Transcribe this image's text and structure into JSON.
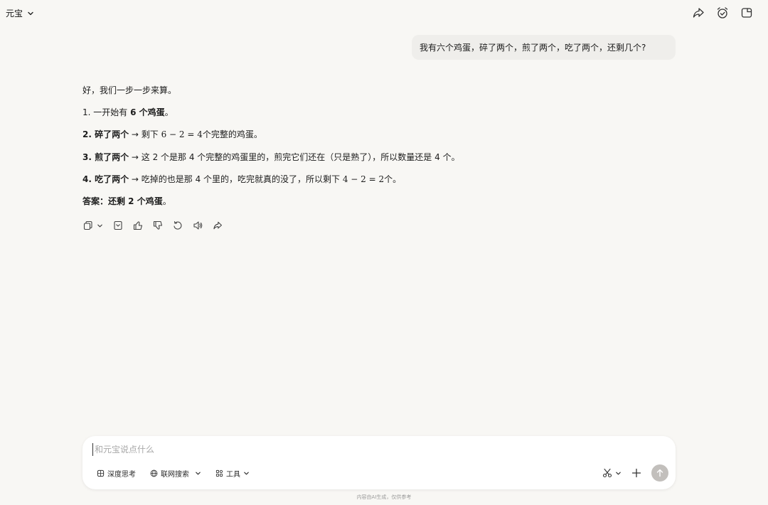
{
  "header": {
    "app_name": "元宝"
  },
  "conversation": {
    "user_message": "我有六个鸡蛋，碎了两个，煎了两个，吃了两个，还剩几个?",
    "answer": {
      "intro": "好，我们一步一步来算。",
      "step1": {
        "prefix": "1. 一开始有 ",
        "bold": "6 个鸡蛋",
        "suffix": "。"
      },
      "step2": {
        "bold": "2. 碎了两个",
        "text1": " → 剩下 ",
        "math": "6 − 2 = 4",
        "text2": "个完整的鸡蛋。"
      },
      "step3": {
        "bold": "3. 煎了两个",
        "text": " → 这 2 个是那 4 个完整的鸡蛋里的，煎完它们还在（只是熟了），所以数量还是 4 个。"
      },
      "step4": {
        "bold": "4. 吃了两个",
        "text1": " → 吃掉的也是那 4 个里的，吃完就真的没了，所以剩下 ",
        "math": "4 − 2 = 2",
        "text2": "个。"
      },
      "conclusion": {
        "bold": "答案：还剩 2 个鸡蛋",
        "suffix": "。"
      }
    }
  },
  "composer": {
    "placeholder": "和元宝说点什么",
    "deep_think_label": "深度思考",
    "web_search_label": "联网搜索",
    "tools_label": "工具"
  },
  "footer_note": "内容由AI生成，仅供参考",
  "icons": {
    "top": [
      "share-icon",
      "alarm-check-icon",
      "new-chat-icon"
    ],
    "actions": [
      "copy-icon",
      "chevron-down-icon",
      "bookmark-icon",
      "thumbs-up-icon",
      "thumbs-down-icon",
      "regenerate-icon",
      "speaker-icon",
      "share-icon"
    ]
  },
  "colors": {
    "background": "#f8f7f4",
    "user_bubble": "#efeeeb",
    "send_button": "#c2bfbc"
  }
}
